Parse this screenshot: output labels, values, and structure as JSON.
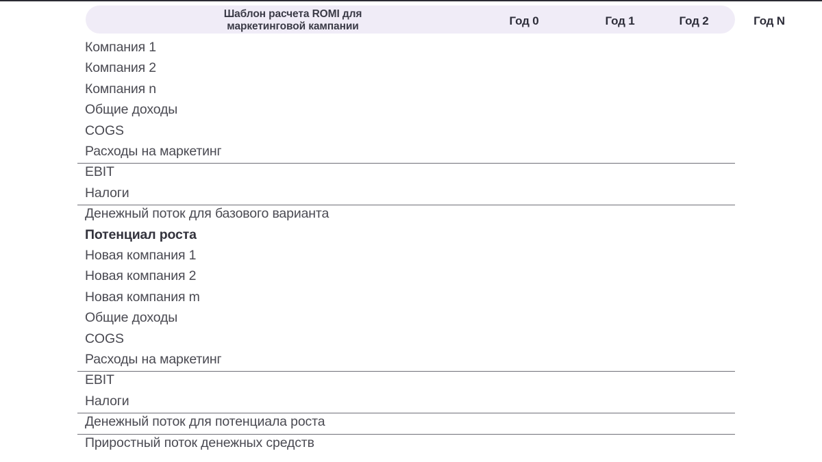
{
  "slide": {
    "background_color": "#ffffff",
    "accent_color": "#f0ecf7",
    "text_color": "#4a4a52",
    "rule_color": "#6e6e76"
  },
  "header": {
    "title": "Шаблон расчета ROMI для маркетинговой кампании",
    "title_line_1": "Шаблон расчета ROMI для",
    "title_line_2": "маркетинговой кампании",
    "columns": [
      {
        "label": "Год 0"
      },
      {
        "label": "Год 1"
      },
      {
        "label": "Год 2"
      },
      {
        "label": "Год N"
      }
    ]
  },
  "rows": [
    {
      "label": "Компания 1",
      "bold": false,
      "rule_above": false
    },
    {
      "label": "Компания 2",
      "bold": false,
      "rule_above": false
    },
    {
      "label": "Компания n",
      "bold": false,
      "rule_above": false
    },
    {
      "label": "Общие доходы",
      "bold": false,
      "rule_above": false
    },
    {
      "label": "COGS",
      "bold": false,
      "rule_above": false
    },
    {
      "label": "Расходы на маркетинг",
      "bold": false,
      "rule_above": false
    },
    {
      "label": "EBIT",
      "bold": false,
      "rule_above": true
    },
    {
      "label": "Налоги",
      "bold": false,
      "rule_above": false
    },
    {
      "label": "Денежный поток для базового варианта",
      "bold": false,
      "rule_above": true
    },
    {
      "label": "Потенциал роста",
      "bold": true,
      "rule_above": false
    },
    {
      "label": "Новая компания 1",
      "bold": false,
      "rule_above": false
    },
    {
      "label": "Новая компания 2",
      "bold": false,
      "rule_above": false
    },
    {
      "label": "Новая компания m",
      "bold": false,
      "rule_above": false
    },
    {
      "label": "Общие доходы",
      "bold": false,
      "rule_above": false
    },
    {
      "label": "COGS",
      "bold": false,
      "rule_above": false
    },
    {
      "label": "Расходы на маркетинг",
      "bold": false,
      "rule_above": false
    },
    {
      "label": "EBIT",
      "bold": false,
      "rule_above": true
    },
    {
      "label": "Налоги",
      "bold": false,
      "rule_above": false
    },
    {
      "label": "Денежный поток для потенциала роста",
      "bold": false,
      "rule_above": true
    },
    {
      "label": "Приростный поток денежных средств",
      "bold": false,
      "rule_above": true
    }
  ]
}
